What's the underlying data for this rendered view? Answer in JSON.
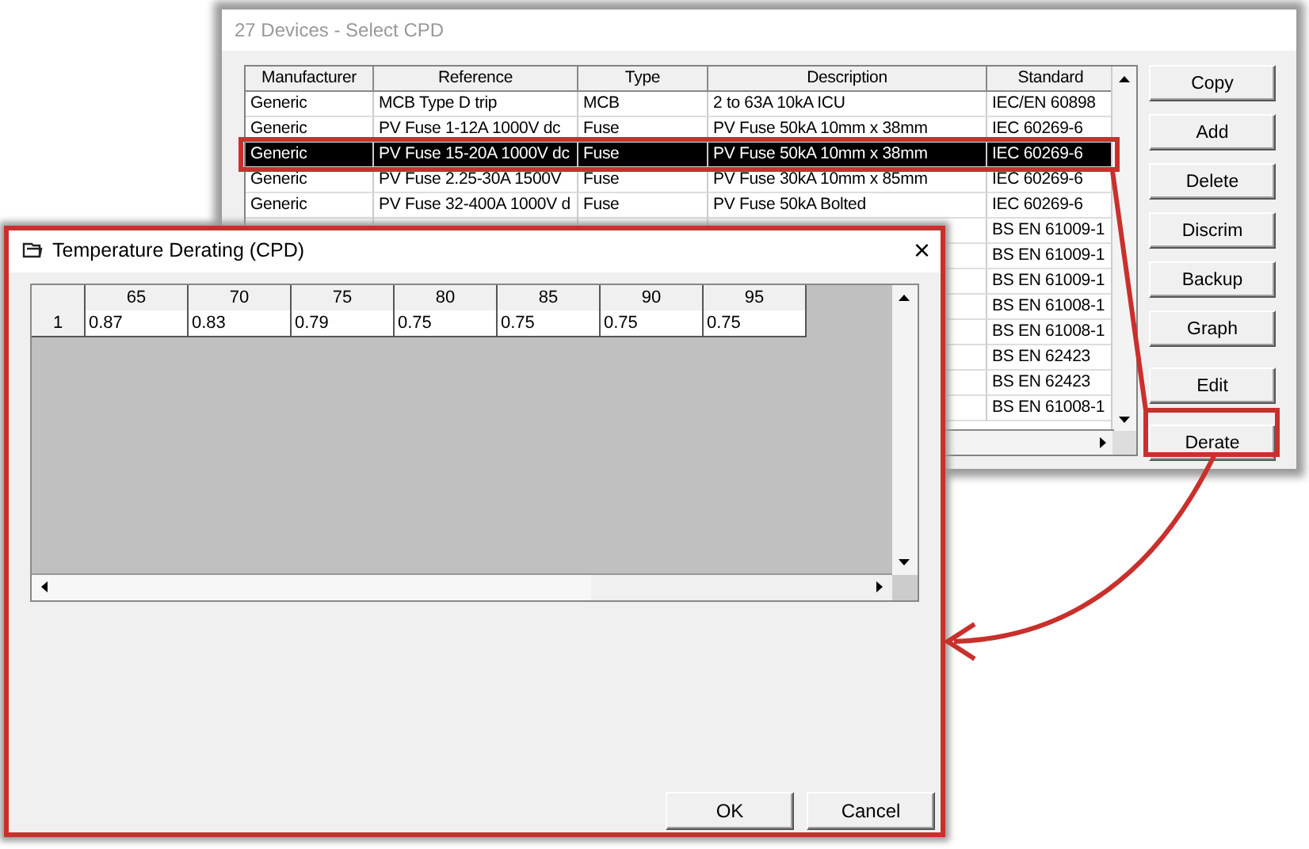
{
  "back_window": {
    "title": "27 Devices - Select CPD",
    "active": false,
    "table": {
      "columns": [
        "Manufacturer",
        "Reference",
        "Type",
        "Description",
        "Standard"
      ],
      "rows": [
        {
          "manufacturer": "Generic",
          "reference": "MCB Type D trip",
          "type": "MCB",
          "description": "2 to 63A 10kA ICU",
          "standard": "IEC/EN 60898",
          "selected": false
        },
        {
          "manufacturer": "Generic",
          "reference": "PV Fuse 1-12A 1000V dc",
          "type": "Fuse",
          "description": "PV Fuse 50kA 10mm x 38mm",
          "standard": "IEC 60269-6",
          "selected": false
        },
        {
          "manufacturer": "Generic",
          "reference": "PV Fuse 15-20A 1000V dc",
          "type": "Fuse",
          "description": "PV Fuse 50kA 10mm x 38mm",
          "standard": "IEC 60269-6",
          "selected": true
        },
        {
          "manufacturer": "Generic",
          "reference": "PV Fuse 2.25-30A 1500V",
          "type": "Fuse",
          "description": "PV Fuse 30kA 10mm x 85mm",
          "standard": "IEC 60269-6",
          "selected": false
        },
        {
          "manufacturer": "Generic",
          "reference": "PV Fuse 32-400A 1000V d",
          "type": "Fuse",
          "description": "PV Fuse 50kA Bolted",
          "standard": "IEC 60269-6",
          "selected": false
        },
        {
          "standard": "BS EN 61009-1",
          "selected": false
        },
        {
          "standard": "BS EN 61009-1",
          "selected": false
        },
        {
          "standard": "BS EN 61009-1",
          "selected": false
        },
        {
          "standard": "BS EN 61008-1",
          "selected": false
        },
        {
          "standard": "BS EN 61008-1",
          "selected": false
        },
        {
          "standard": "BS EN 62423",
          "selected": false
        },
        {
          "standard": "BS EN 62423",
          "selected": false
        },
        {
          "standard": "BS EN 61008-1",
          "selected": false
        }
      ]
    },
    "buttons": [
      "Copy",
      "Add",
      "Delete",
      "Discrim",
      "Backup",
      "Graph",
      "Edit",
      "Derate"
    ]
  },
  "dialog": {
    "title": "Temperature Derating (CPD)",
    "close": "×",
    "grid": {
      "columns": [
        "65",
        "70",
        "75",
        "80",
        "85",
        "90",
        "95"
      ],
      "rows": [
        {
          "header": "1",
          "values": [
            "0.87",
            "0.83",
            "0.79",
            "0.75",
            "0.75",
            "0.75",
            "0.75"
          ]
        }
      ]
    },
    "buttons": [
      "OK",
      "Cancel"
    ]
  },
  "annotations": [
    {
      "kind": "box"
    },
    {
      "kind": "box"
    },
    {
      "kind": "box"
    },
    {
      "kind": "line"
    },
    {
      "kind": "arrow"
    }
  ]
}
